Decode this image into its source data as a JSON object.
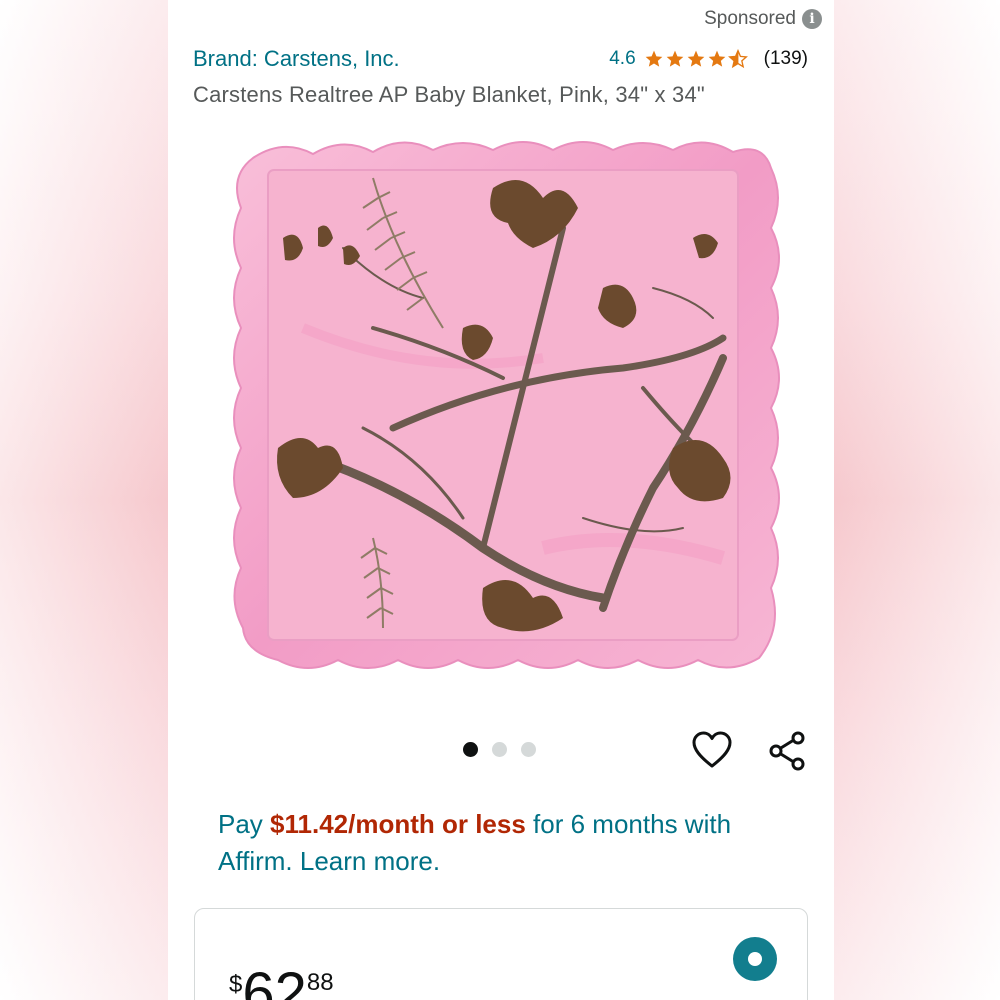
{
  "header": {
    "sponsored_label": "Sponsored",
    "info_icon_glyph": "i"
  },
  "product": {
    "brand": "Brand: Carstens, Inc.",
    "rating": "4.6",
    "stars": 4.6,
    "rating_count": "(139)",
    "title": "Carstens Realtree AP Baby Blanket, Pink, 34\" x 34\""
  },
  "gallery": {
    "image_count": 3,
    "active_index": 0
  },
  "financing": {
    "prefix": "Pay ",
    "amount": "$11.42/month or less",
    "suffix": " for 6 months with Affirm. Learn more."
  },
  "buy_box": {
    "currency_symbol": "$",
    "price_whole": "62",
    "price_fraction": "88"
  },
  "colors": {
    "link": "#007185",
    "price_red": "#b12704",
    "star": "#e47911",
    "radio": "#127e8e",
    "blanket_pink": "#f6b3cf"
  },
  "icons": {
    "info": "info-icon",
    "star": "star-icon",
    "heart": "heart-icon",
    "share": "share-icon",
    "radio": "radio-selected-icon"
  }
}
